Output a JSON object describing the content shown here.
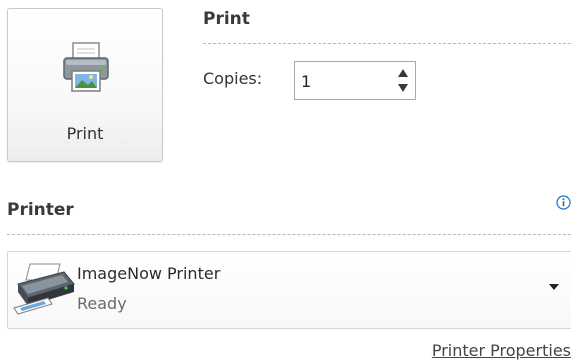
{
  "print_section": {
    "title": "Print",
    "print_button_label": "Print",
    "copies_label": "Copies:",
    "copies_value": "1"
  },
  "printer_section": {
    "title": "Printer",
    "info_icon": "info-icon",
    "selected_printer": {
      "name": "ImageNow Printer",
      "status": "Ready"
    },
    "properties_link": "Printer Properties"
  },
  "icons": {
    "print_button": "printer-icon",
    "printer_device": "printer-device-icon",
    "dropdown": "chevron-down-icon"
  },
  "colors": {
    "info_accent": "#1f6fc6",
    "border": "#c9c9c9"
  }
}
